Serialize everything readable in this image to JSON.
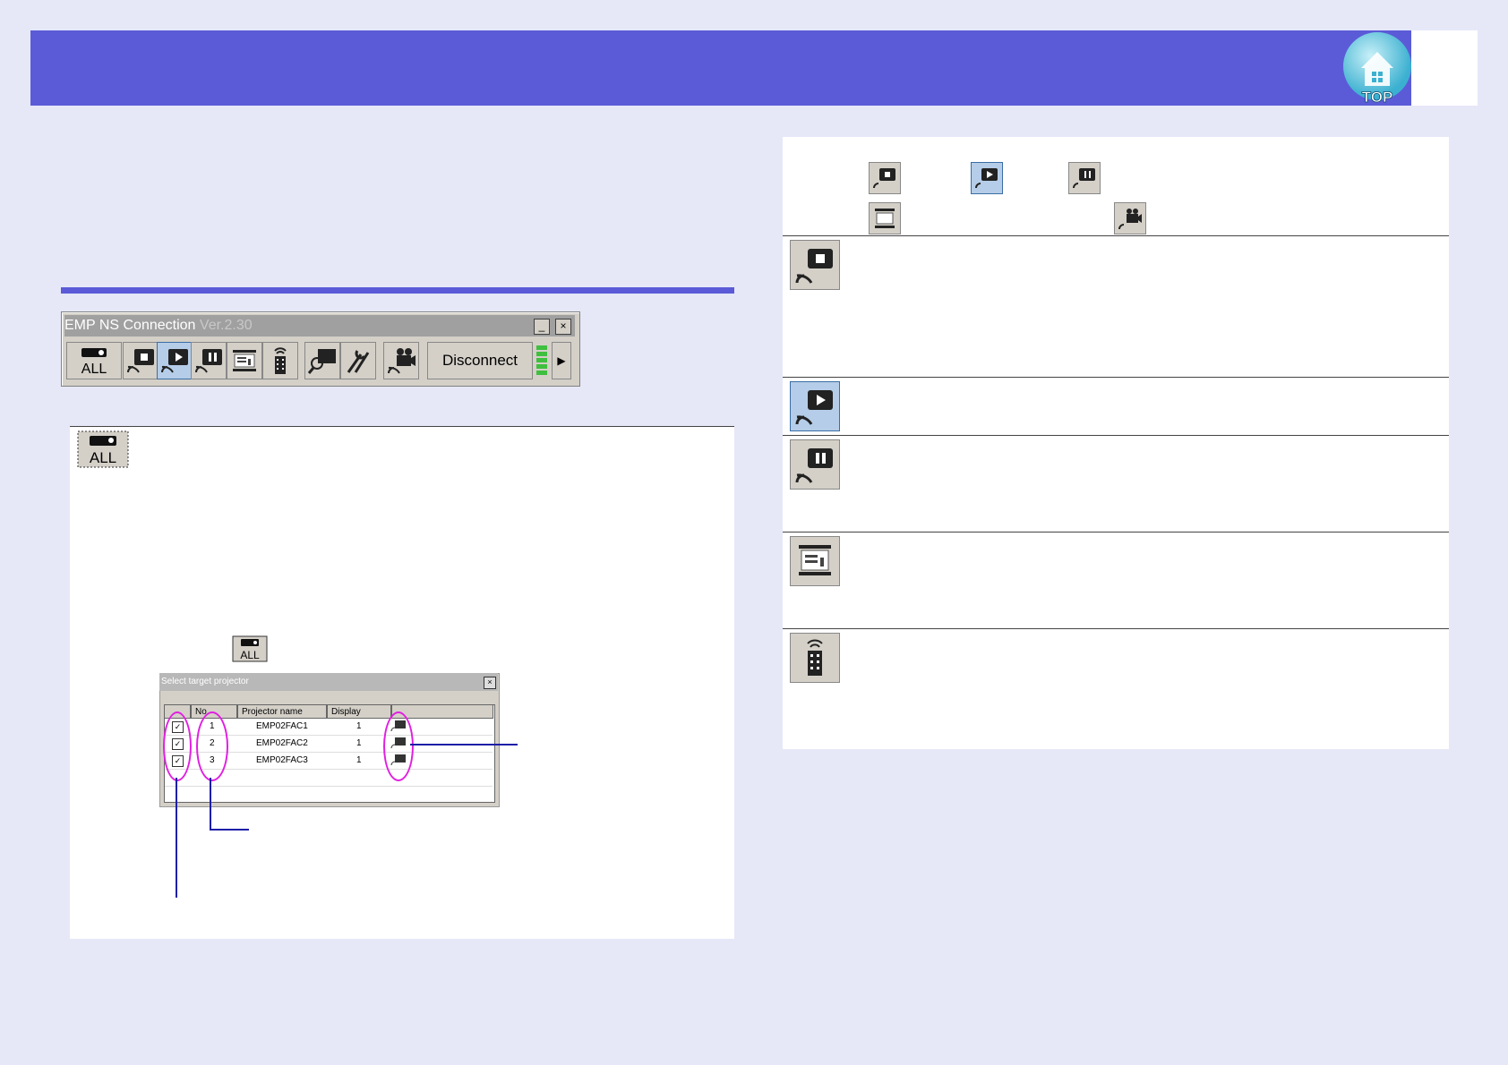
{
  "toolbar": {
    "title": "EMP NS Connection",
    "version": "Ver.2.30",
    "minimize_glyph": "_",
    "close_glyph": "×",
    "disconnect_label": "Disconnect",
    "all_label": "ALL",
    "buttons": [
      "projector-all-icon",
      "stop-icon",
      "play-icon",
      "pause-icon",
      "screen-icon",
      "remote-icon",
      "search-icon",
      "tools-icon",
      "movie-icon"
    ]
  },
  "dialog": {
    "title": "Select target projector",
    "close_glyph": "×",
    "columns": [
      "No.",
      "Projector name",
      "Display"
    ],
    "rows": [
      {
        "no": "1",
        "name": "EMP02FAC1",
        "display": "1",
        "checked": "✓"
      },
      {
        "no": "2",
        "name": "EMP02FAC2",
        "display": "1",
        "checked": "✓"
      },
      {
        "no": "3",
        "name": "EMP02FAC3",
        "display": "1",
        "checked": "✓"
      }
    ]
  },
  "right_panel": {
    "header_icons": [
      "stop-icon",
      "play-icon",
      "pause-icon",
      "screen-icon",
      "movie-icon"
    ],
    "rows": [
      "stop-icon",
      "play-icon",
      "pause-icon",
      "screen-icon",
      "remote-icon"
    ]
  },
  "colors": {
    "header": "#5b5bd8",
    "background": "#e6e8f8",
    "highlight_ellipse": "#e020e0",
    "callout_line": "#1e1ea8"
  },
  "logo": {
    "text": "TOP"
  }
}
